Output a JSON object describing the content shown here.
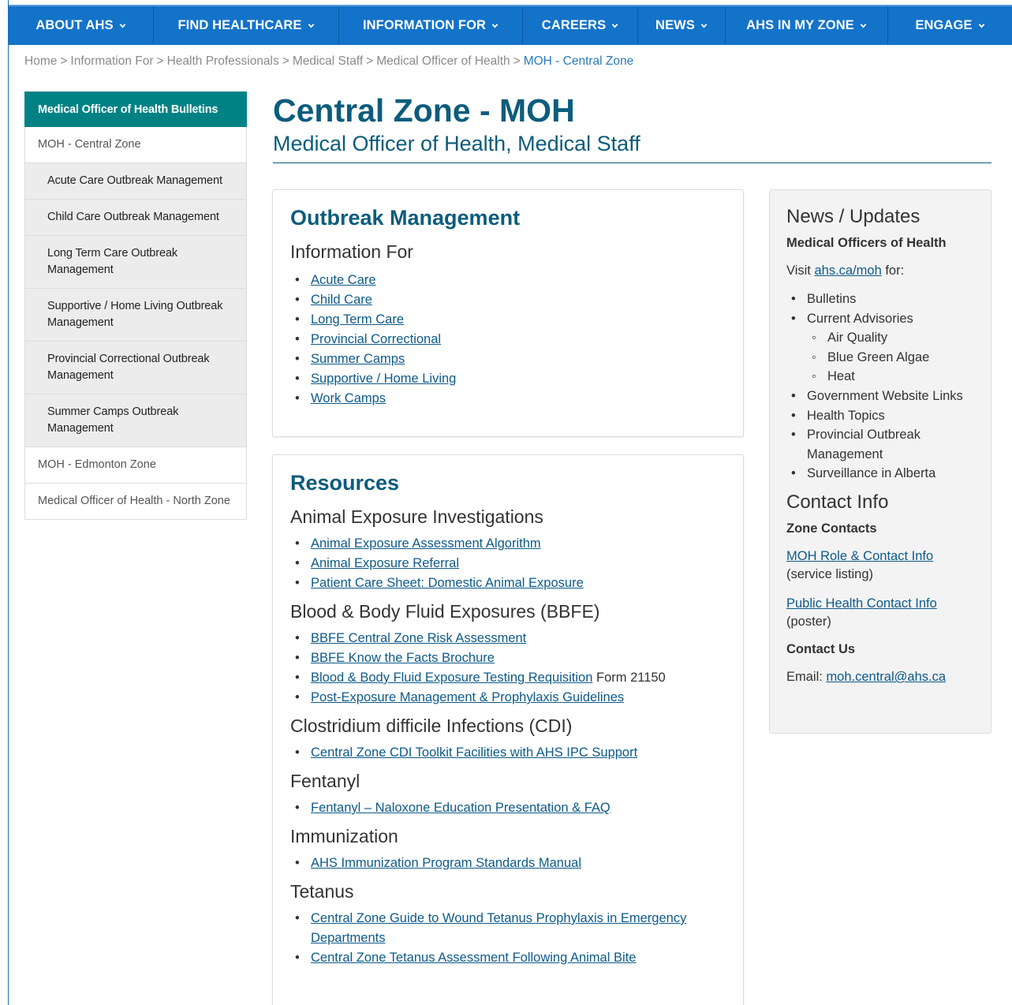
{
  "nav": {
    "items": [
      {
        "label": "ABOUT AHS"
      },
      {
        "label": "FIND HEALTHCARE"
      },
      {
        "label": "INFORMATION FOR"
      },
      {
        "label": "CAREERS"
      },
      {
        "label": "NEWS"
      },
      {
        "label": "AHS IN MY ZONE"
      },
      {
        "label": "ENGAGE"
      }
    ]
  },
  "breadcrumb": {
    "items": [
      "Home",
      "Information For",
      "Health Professionals",
      "Medical Staff",
      "Medical Officer of Health",
      "MOH - Central Zone"
    ],
    "separator": ">"
  },
  "sidebar": {
    "header": "Medical Officer of Health Bulletins",
    "items": [
      {
        "label": "MOH - Central Zone"
      },
      {
        "label": "Acute Care Outbreak Management"
      },
      {
        "label": "Child Care Outbreak Management"
      },
      {
        "label": "Long Term Care Outbreak Management"
      },
      {
        "label": "Supportive / Home Living Outbreak Management"
      },
      {
        "label": "Provincial Correctional Outbreak Management"
      },
      {
        "label": "Summer Camps Outbreak Management"
      },
      {
        "label": "MOH - Edmonton Zone"
      },
      {
        "label": "Medical Officer of Health - North Zone"
      }
    ]
  },
  "page": {
    "title": "Central Zone - MOH",
    "subtitle": "Medical Officer of Health, Medical Staff"
  },
  "outbreak": {
    "heading": "Outbreak Management",
    "subheading": "Information For",
    "links": [
      "Acute Care",
      "Child Care",
      "Long Term Care",
      "Provincial Correctional",
      "Summer Camps",
      "Supportive / Home Living",
      "Work Camps"
    ]
  },
  "resources": {
    "heading": "Resources",
    "sections": [
      {
        "title": "Animal Exposure Investigations",
        "links": [
          {
            "text": "Animal Exposure Assessment Algorithm",
            "suffix": ""
          },
          {
            "text": "Animal Exposure Referral",
            "suffix": ""
          },
          {
            "text": "Patient Care Sheet: Domestic Animal Exposure",
            "suffix": ""
          }
        ]
      },
      {
        "title": "Blood & Body Fluid Exposures (BBFE)",
        "links": [
          {
            "text": "BBFE Central Zone Risk Assessment",
            "suffix": ""
          },
          {
            "text": "BBFE Know the Facts Brochure",
            "suffix": ""
          },
          {
            "text": "Blood & Body Fluid Exposure Testing Requisition",
            "suffix": " Form 21150"
          },
          {
            "text": "Post-Exposure Management & Prophylaxis Guidelines",
            "suffix": ""
          }
        ]
      },
      {
        "title": "Clostridium difficile Infections (CDI)",
        "links": [
          {
            "text": "Central Zone CDI Toolkit Facilities with AHS IPC Support",
            "suffix": ""
          }
        ]
      },
      {
        "title": "Fentanyl",
        "links": [
          {
            "text": "Fentanyl – Naloxone Education Presentation & FAQ",
            "suffix": ""
          }
        ]
      },
      {
        "title": "Immunization",
        "links": [
          {
            "text": "AHS Immunization Program Standards Manual",
            "suffix": ""
          }
        ]
      },
      {
        "title": "Tetanus",
        "links": [
          {
            "text": "Central Zone Guide to Wound Tetanus Prophylaxis in Emergency Departments",
            "suffix": ""
          },
          {
            "text": "Central Zone Tetanus Assessment Following Animal Bite",
            "suffix": ""
          }
        ]
      }
    ]
  },
  "news": {
    "heading": "News / Updates",
    "moh_heading": "Medical Officers of Health",
    "visit_prefix": "Visit ",
    "visit_link": "ahs.ca/moh",
    "visit_suffix": " for:",
    "list": [
      "Bulletins",
      "Current Advisories",
      "Government Website Links",
      "Health Topics",
      "Provincial Outbreak Management",
      "Surveillance in Alberta"
    ],
    "advisories": [
      "Air Quality",
      "Blue Green Algae",
      "Heat"
    ],
    "contact_heading": "Contact Info",
    "zone_contacts": "Zone Contacts",
    "moh_role_link": "MOH Role & Contact Info",
    "moh_role_note": "(service listing)",
    "ph_link": "Public Health Contact Info",
    "ph_note": "(poster)",
    "contact_us": "Contact Us",
    "email_prefix": "Email: ",
    "email": "moh.central@ahs.ca"
  }
}
